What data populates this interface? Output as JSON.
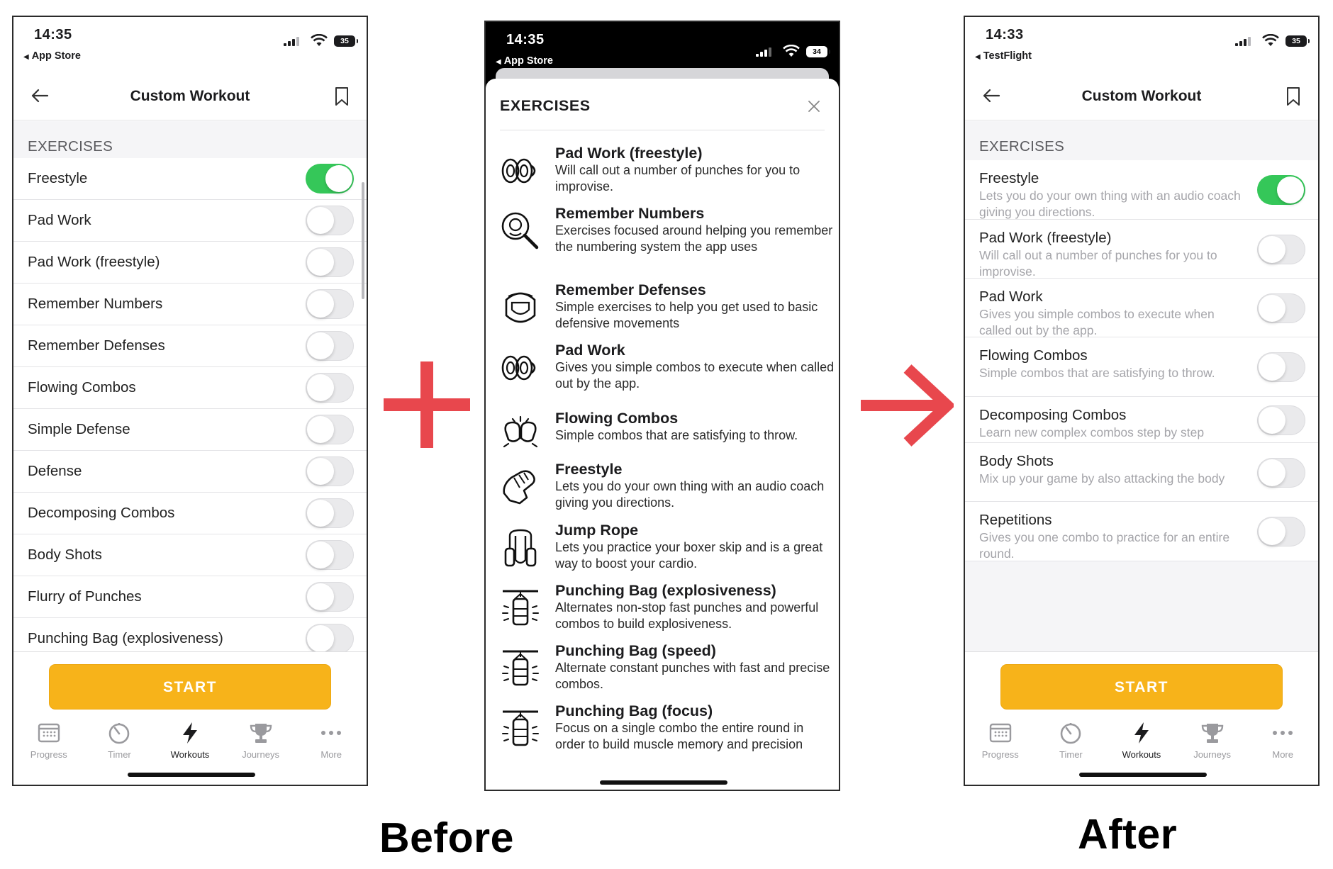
{
  "before_screen": {
    "status": {
      "time": "14:35",
      "back_app": "App Store",
      "battery": "35"
    },
    "nav_title": "Custom Workout",
    "section_header": "EXERCISES",
    "exercises": [
      {
        "label": "Freestyle",
        "enabled": true
      },
      {
        "label": "Pad Work",
        "enabled": false
      },
      {
        "label": "Pad Work (freestyle)",
        "enabled": false
      },
      {
        "label": "Remember Numbers",
        "enabled": false
      },
      {
        "label": "Remember Defenses",
        "enabled": false
      },
      {
        "label": "Flowing Combos",
        "enabled": false
      },
      {
        "label": "Simple Defense",
        "enabled": false
      },
      {
        "label": "Defense",
        "enabled": false
      },
      {
        "label": "Decomposing Combos",
        "enabled": false
      },
      {
        "label": "Body Shots",
        "enabled": false
      },
      {
        "label": "Flurry of Punches",
        "enabled": false
      },
      {
        "label": "Punching Bag (explosiveness)",
        "enabled": false
      }
    ],
    "start_label": "START"
  },
  "exercises_sheet": {
    "status": {
      "time": "14:35",
      "back_app": "App Store",
      "battery": "34"
    },
    "title": "EXERCISES",
    "items": [
      {
        "icon": "pad-icon",
        "title": "Pad Work (freestyle)",
        "desc": "Will call out a number of punches for you to improvise."
      },
      {
        "icon": "magnifier-icon",
        "title": "Remember Numbers",
        "desc": "Exercises focused around helping you remember the numbering system the app uses"
      },
      {
        "icon": "headgear-icon",
        "title": "Remember Defenses",
        "desc": "Simple exercises to help you get used to basic defensive movements"
      },
      {
        "icon": "pad-icon",
        "title": "Pad Work",
        "desc": "Gives you simple combos to execute when called out by the app."
      },
      {
        "icon": "gloves-icon",
        "title": "Flowing Combos",
        "desc": "Simple combos that are satisfying to throw."
      },
      {
        "icon": "glove-icon",
        "title": "Freestyle",
        "desc": "Lets you do your own thing with an audio coach giving you directions."
      },
      {
        "icon": "jump-rope-icon",
        "title": "Jump Rope",
        "desc": "Lets you practice your boxer skip and is a great way to boost your cardio."
      },
      {
        "icon": "punching-bag-icon",
        "title": "Punching Bag (explosiveness)",
        "desc": "Alternates non-stop fast punches and powerful combos to build explosiveness."
      },
      {
        "icon": "punching-bag-icon",
        "title": "Punching Bag (speed)",
        "desc": "Alternate constant punches with fast and precise combos."
      },
      {
        "icon": "punching-bag-icon",
        "title": "Punching Bag (focus)",
        "desc": "Focus on a single combo the entire round in order to build muscle memory and precision"
      }
    ]
  },
  "after_screen": {
    "status": {
      "time": "14:33",
      "back_app": "TestFlight",
      "battery": "35"
    },
    "nav_title": "Custom Workout",
    "section_header": "EXERCISES",
    "exercises": [
      {
        "label": "Freestyle",
        "desc": "Lets you do your own thing with an audio coach giving you directions.",
        "enabled": true
      },
      {
        "label": "Pad Work (freestyle)",
        "desc": "Will call out a number of punches for you to improvise.",
        "enabled": false
      },
      {
        "label": "Pad Work",
        "desc": "Gives you simple combos to execute when called out by the app.",
        "enabled": false
      },
      {
        "label": "Flowing Combos",
        "desc": "Simple combos that are satisfying to throw.",
        "enabled": false
      },
      {
        "label": "Decomposing Combos",
        "desc": "Learn new complex combos step by step",
        "enabled": false
      },
      {
        "label": "Body Shots",
        "desc": "Mix up your game by also attacking the body",
        "enabled": false
      },
      {
        "label": "Repetitions",
        "desc": "Gives you one combo to practice for an entire round.",
        "enabled": false
      }
    ],
    "start_label": "START"
  },
  "tabbar": [
    {
      "label": "Progress",
      "icon": "calendar-icon"
    },
    {
      "label": "Timer",
      "icon": "timer-icon"
    },
    {
      "label": "Workouts",
      "icon": "lightning-icon"
    },
    {
      "label": "Journeys",
      "icon": "trophy-icon"
    },
    {
      "label": "More",
      "icon": "more-icon"
    }
  ],
  "active_tab": "Workouts",
  "captions": {
    "before": "Before",
    "after": "After"
  },
  "colors": {
    "accent_start": "#f7b31a",
    "toggle_on": "#35c759",
    "annotation": "#e8474d"
  }
}
